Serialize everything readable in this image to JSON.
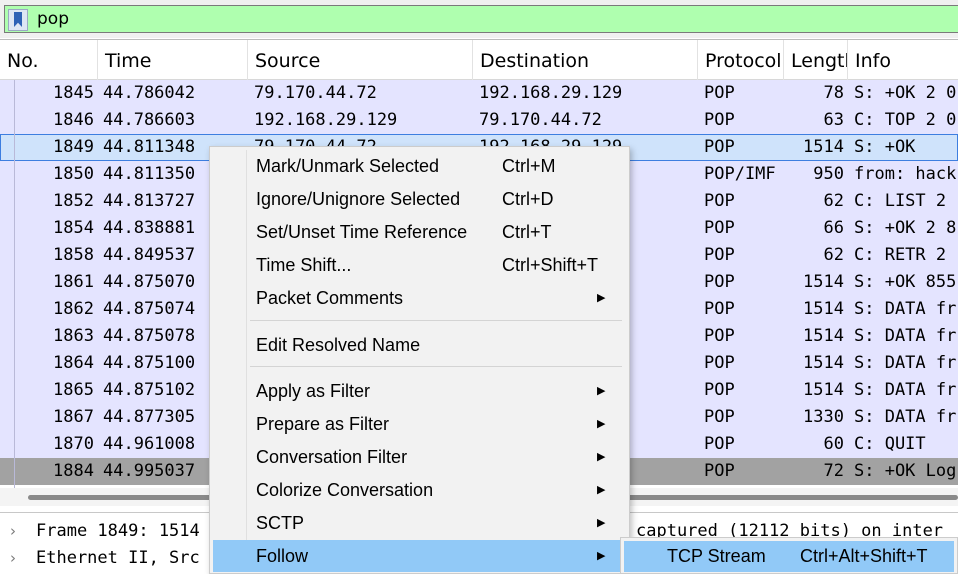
{
  "filter": {
    "value": "pop"
  },
  "columns": [
    "No.",
    "Time",
    "Source",
    "Destination",
    "Protocol",
    "Length",
    "Info"
  ],
  "packets": [
    {
      "no": "1845",
      "time": "44.786042",
      "src": "79.170.44.72",
      "dst": "192.168.29.129",
      "proto": "POP",
      "len": "78",
      "info": "S: +OK 2 0"
    },
    {
      "no": "1846",
      "time": "44.786603",
      "src": "192.168.29.129",
      "dst": "79.170.44.72",
      "proto": "POP",
      "len": "63",
      "info": "C: TOP 2 0"
    },
    {
      "no": "1849",
      "time": "44.811348",
      "src": "79.170.44.72",
      "dst": "192.168.29.129",
      "proto": "POP",
      "len": "1514",
      "info": "S: +OK"
    },
    {
      "no": "1850",
      "time": "44.811350",
      "src": "",
      "dst": "",
      "proto": "POP/IMF",
      "len": "950",
      "info": "from: hack"
    },
    {
      "no": "1852",
      "time": "44.813727",
      "src": "",
      "dst": "",
      "proto": "POP",
      "len": "62",
      "info": "C: LIST 2"
    },
    {
      "no": "1854",
      "time": "44.838881",
      "src": "",
      "dst": "",
      "proto": "POP",
      "len": "66",
      "info": "S: +OK 2 8"
    },
    {
      "no": "1858",
      "time": "44.849537",
      "src": "",
      "dst": "",
      "proto": "POP",
      "len": "62",
      "info": "C: RETR 2"
    },
    {
      "no": "1861",
      "time": "44.875070",
      "src": "",
      "dst": "",
      "proto": "POP",
      "len": "1514",
      "info": "S: +OK 855"
    },
    {
      "no": "1862",
      "time": "44.875074",
      "src": "",
      "dst": "",
      "proto": "POP",
      "len": "1514",
      "info": "S: DATA fr"
    },
    {
      "no": "1863",
      "time": "44.875078",
      "src": "",
      "dst": "",
      "proto": "POP",
      "len": "1514",
      "info": "S: DATA fr"
    },
    {
      "no": "1864",
      "time": "44.875100",
      "src": "",
      "dst": "",
      "proto": "POP",
      "len": "1514",
      "info": "S: DATA fr"
    },
    {
      "no": "1865",
      "time": "44.875102",
      "src": "",
      "dst": "",
      "proto": "POP",
      "len": "1514",
      "info": "S: DATA fr"
    },
    {
      "no": "1867",
      "time": "44.877305",
      "src": "",
      "dst": "",
      "proto": "POP",
      "len": "1330",
      "info": "S: DATA fr"
    },
    {
      "no": "1870",
      "time": "44.961008",
      "src": "",
      "dst": "",
      "proto": "POP",
      "len": "60",
      "info": "C: QUIT"
    },
    {
      "no": "1884",
      "time": "44.995037",
      "src": "",
      "dst": "",
      "proto": "POP",
      "len": "72",
      "info": "S: +OK Log"
    }
  ],
  "selected_row_index": 2,
  "dark_row_index": 14,
  "details": [
    {
      "left": "Frame 1849: 1514",
      "right": "captured (12112 bits) on inter"
    },
    {
      "left": "Ethernet II, Src",
      "right": ""
    }
  ],
  "context_menu": {
    "items": [
      {
        "label": "Mark/Unmark Selected",
        "shortcut": "Ctrl+M",
        "submenu": false
      },
      {
        "label": "Ignore/Unignore Selected",
        "shortcut": "Ctrl+D",
        "submenu": false
      },
      {
        "label": "Set/Unset Time Reference",
        "shortcut": "Ctrl+T",
        "submenu": false
      },
      {
        "label": "Time Shift...",
        "shortcut": "Ctrl+Shift+T",
        "submenu": false
      },
      {
        "label": "Packet Comments",
        "shortcut": "",
        "submenu": true
      },
      {
        "label": "Edit Resolved Name",
        "shortcut": "",
        "submenu": false
      },
      {
        "label": "Apply as Filter",
        "shortcut": "",
        "submenu": true
      },
      {
        "label": "Prepare as Filter",
        "shortcut": "",
        "submenu": true
      },
      {
        "label": "Conversation Filter",
        "shortcut": "",
        "submenu": true
      },
      {
        "label": "Colorize Conversation",
        "shortcut": "",
        "submenu": true
      },
      {
        "label": "SCTP",
        "shortcut": "",
        "submenu": true
      },
      {
        "label": "Follow",
        "shortcut": "",
        "submenu": true
      }
    ],
    "highlighted_index": 11,
    "submenu_arrow": "▶"
  },
  "follow_submenu": {
    "label": "TCP Stream",
    "shortcut": "Ctrl+Alt+Shift+T"
  },
  "colors": {
    "filter_bg": "#afffaf",
    "row_bg": "#e4e4ff",
    "selected_row_bg": "#cfe3fb",
    "dark_row_bg": "#a2a2a2",
    "menu_highlight": "#91c9f7"
  }
}
